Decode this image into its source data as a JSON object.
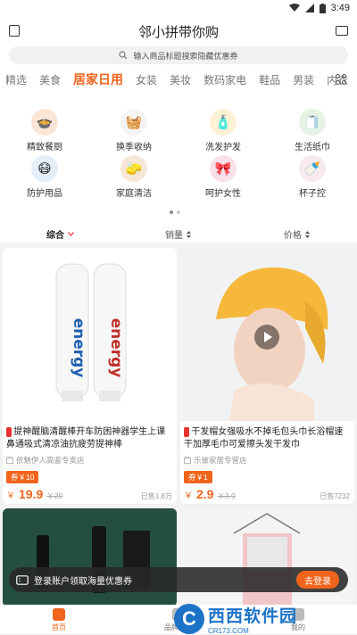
{
  "status": {
    "time": "3:49"
  },
  "header": {
    "title": "邻小拼带你购"
  },
  "search": {
    "placeholder": "输入商品标题搜索隐藏优惠券"
  },
  "tabs": [
    "精选",
    "美食",
    "居家日用",
    "女装",
    "美妆",
    "数码家电",
    "鞋品",
    "男装",
    "内衣"
  ],
  "categories": [
    {
      "label": "精致餐厨",
      "icon": "pot-icon",
      "glyph": "🍲",
      "color": "#fbe6d6"
    },
    {
      "label": "换季收纳",
      "icon": "storage-icon",
      "glyph": "🧺",
      "color": "#f4f4f4"
    },
    {
      "label": "洗发护发",
      "icon": "shampoo-icon",
      "glyph": "🧴",
      "color": "#fff1d6"
    },
    {
      "label": "生活纸巾",
      "icon": "tissue-icon",
      "glyph": "🧻",
      "color": "#e6f3e4"
    },
    {
      "label": "防护用品",
      "icon": "mask-icon",
      "glyph": "😷",
      "color": "#e3eef8"
    },
    {
      "label": "家庭清洁",
      "icon": "cleaner-icon",
      "glyph": "🧽",
      "color": "#f6e7d8"
    },
    {
      "label": "呵护女性",
      "icon": "pad-icon",
      "glyph": "🎀",
      "color": "#f9e1ec"
    },
    {
      "label": "杯子控",
      "icon": "cup-icon",
      "glyph": "🍼",
      "color": "#f7e9ee"
    }
  ],
  "sort": {
    "composite": "综合",
    "sales": "销量",
    "price": "价格"
  },
  "products": [
    {
      "title": "提神醒脑清醒棒开车防困神器学生上课鼻通吸式清凉油抗疲劳提神棒",
      "shop": "依魅伊人高鉴专卖店",
      "coupon": "券￥10",
      "price_symbol": "￥",
      "price": "19.9",
      "original": "￥29",
      "sold": "已售1.8万",
      "image_text": "energy"
    },
    {
      "title": "干发帽女强吸水不掉毛包头巾长浴帽速干加厚毛巾可爱擦头发干发巾",
      "shop": "乐彼家居专营店",
      "coupon": "券￥1",
      "price_symbol": "￥",
      "price": "2.9",
      "original": "￥3.9",
      "sold": "已售7232"
    }
  ],
  "toast": {
    "text": "登录账户领取海量优惠券",
    "button": "去登录"
  },
  "bottom_nav": {
    "home": "首页",
    "brand": "品牌好货",
    "mine": "我的"
  },
  "watermark": {
    "main": "西西软件园",
    "sub": "CR173.COM",
    "logo": "C"
  },
  "colors": {
    "accent": "#f0641c",
    "tag_red": "#e8322d"
  }
}
